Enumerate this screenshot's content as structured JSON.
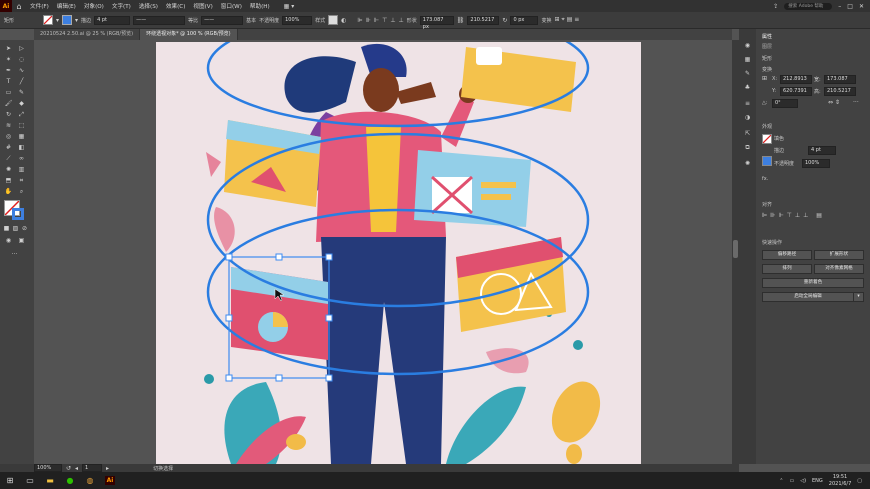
{
  "app": {
    "logo": "Ai",
    "home_icon": "home-icon"
  },
  "menu": [
    "文件(F)",
    "编辑(E)",
    "对象(O)",
    "文字(T)",
    "选择(S)",
    "效果(C)",
    "视图(V)",
    "窗口(W)",
    "帮助(H)"
  ],
  "menu_right": {
    "search_placeholder": "搜索 Adobe 帮助",
    "minimize": "–",
    "maximize": "□",
    "close": "✕"
  },
  "control": {
    "object_type": "矩形",
    "stroke_label": "描边",
    "stroke_value": "4 pt",
    "brush_label": "等比",
    "style_label": "基本",
    "opacity_label": "不透明度",
    "opacity_value": "100%",
    "style2_label": "样式",
    "shape_label": "形状",
    "w_value": "173.087 px",
    "h_value": "210.5217",
    "corner_value": "0 px",
    "transform_label": "变换"
  },
  "tabs": [
    "20210524 2.50.ai @ 25 % (RGB/预览)",
    "环绕透视对象* @ 100 % (RGB/预览)"
  ],
  "props": {
    "tab_properties": "属性",
    "tab_layers": "图层",
    "section_shape": "矩形",
    "section_transform": "变换",
    "x_label": "X:",
    "x_value": "212.8913",
    "y_label": "Y:",
    "y_value": "620.7391",
    "w_label": "宽:",
    "w_value": "173.087",
    "h_label": "高:",
    "h_value": "210.5217",
    "angle_label": "△:",
    "angle_value": "0°",
    "section_appearance": "外观",
    "fill_label": "填色",
    "stroke_label": "描边",
    "stroke_value": "4 pt",
    "opacity_label": "不透明度",
    "opacity_value": "100%",
    "fx_label": "fx.",
    "section_align": "对齐",
    "section_quick": "快速操作",
    "btn_offset": "偏移路径",
    "btn_expand": "扩展形状",
    "btn_arrange": "排列",
    "btn_align_pixel": "对齐像素网格",
    "btn_recolor": "重新着色",
    "btn_global_edit": "启动全局编辑"
  },
  "status": {
    "zoom": "100%",
    "artboard_num": "1",
    "tool_name": "切换选择"
  },
  "taskbar": {
    "time": "19:51",
    "date": "2021/6/7",
    "lang": "ENG",
    "app_label": "Ai"
  },
  "colors": {
    "selection_blue": "#3d8bf0",
    "ring_blue": "#2a7de1",
    "artboard_bg": "#efe3e6",
    "jacket_pink": "#e4587a",
    "shirt_yellow": "#f5c43a",
    "jeans_navy": "#253a7a",
    "card_pink": "#e0506f",
    "card_blue": "#93cfe8",
    "card_yellow": "#f4c24c"
  }
}
